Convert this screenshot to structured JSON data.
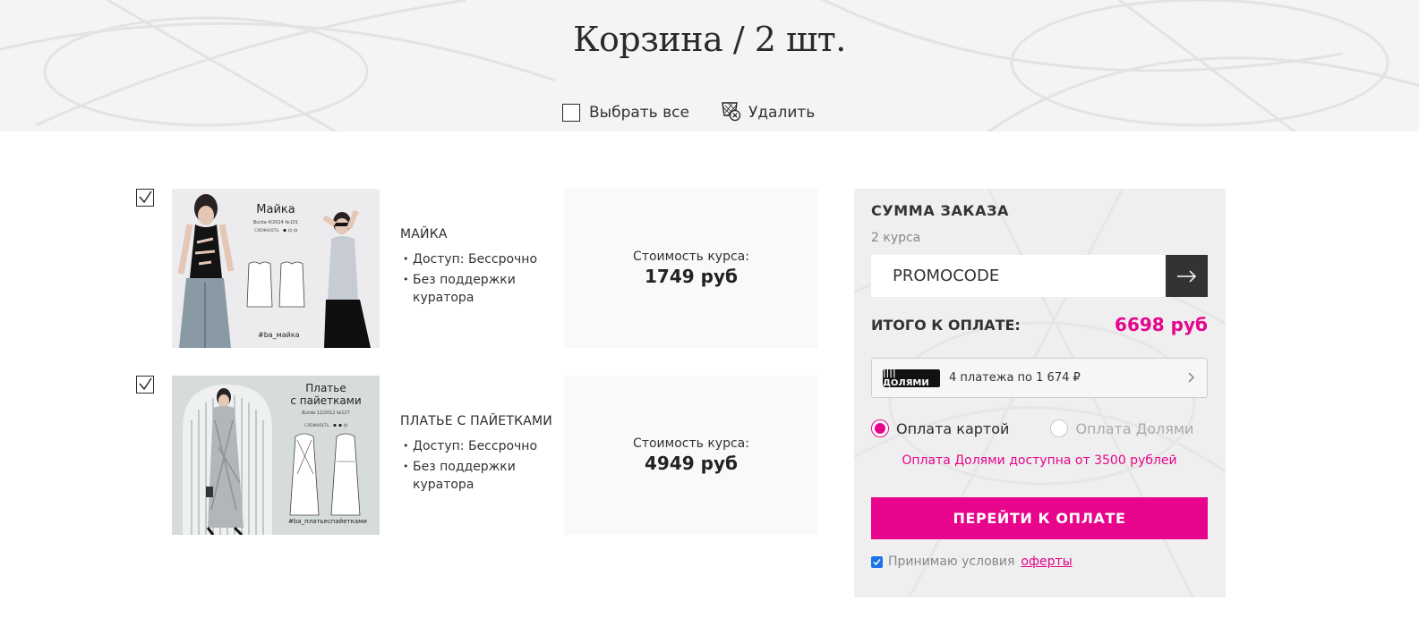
{
  "page": {
    "title": "Корзина / 2 шт."
  },
  "toolbar": {
    "select_all": "Выбрать все",
    "delete": "Удалить"
  },
  "items": [
    {
      "title": "МАЙКА",
      "features": [
        "Доступ: Бессрочно",
        "Без поддержки куратора"
      ],
      "price_label": "Стоимость курса:",
      "price": "1749 руб",
      "checked": true,
      "thumb": {
        "heading": "Майка",
        "sub": "Burda 4/2024 №101",
        "difficulty": "СЛОЖНОСТЬ",
        "tag": "#ba_майка",
        "bg": "#e9e9eb"
      }
    },
    {
      "title": "ПЛАТЬЕ С ПАЙЕТКАМИ",
      "features": [
        "Доступ: Бессрочно",
        "Без поддержки куратора"
      ],
      "price_label": "Стоимость курса:",
      "price": "4949 руб",
      "checked": true,
      "thumb": {
        "heading1": "Платье",
        "heading2": "с пайетками",
        "sub": "Burda 12/2012 №127",
        "difficulty": "СЛОЖНОСТЬ",
        "tag": "#ba_платьеспайетками",
        "bg": "#d3dad8"
      }
    }
  ],
  "summary": {
    "title": "СУММА ЗАКАЗА",
    "count": "2 курса",
    "promo_placeholder": "PROMOCODE",
    "total_label": "ИТОГО К ОПЛАТЕ:",
    "total_value": "6698 руб",
    "dolyami_logo": "||||ДОЛЯМИ",
    "dolyami_text": "4 платежа по 1 674 ₽",
    "pay_card": "Оплата картой",
    "pay_dolyami": "Оплата Долями",
    "note": "Оплата Долями доступна от 3500 рублей",
    "checkout": "ПЕРЕЙТИ К ОПЛАТЕ",
    "terms": "Принимаю условия",
    "terms_link": "оферты"
  },
  "colors": {
    "accent": "#e6058b",
    "dark": "#333333",
    "panel": "#efefef"
  }
}
